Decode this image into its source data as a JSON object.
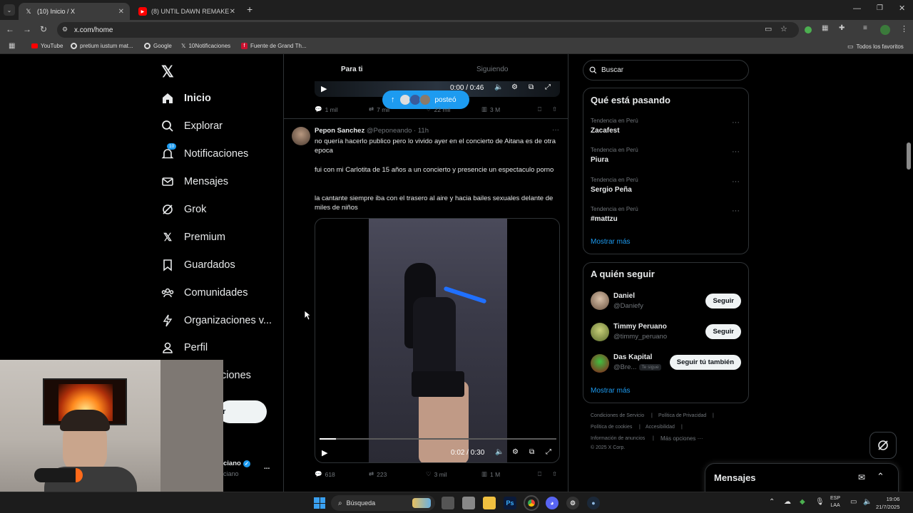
{
  "browser": {
    "tabs": [
      {
        "title": "(10) Inicio / X",
        "favicon": "x-logo-icon",
        "active": true
      },
      {
        "title": "(8) UNTIL DAWN REMAKE Gam",
        "favicon": "youtube-icon",
        "active": false
      }
    ],
    "new_tab_symbol": "+",
    "url": "x.com/home",
    "bookmarks": [
      {
        "label": "YouTube",
        "icon": "youtube-icon"
      },
      {
        "label": "pretium iustum mat...",
        "icon": "google-icon"
      },
      {
        "label": "Google",
        "icon": "google-icon"
      },
      {
        "label": "10Notificaciones",
        "icon": "x-logo-icon"
      },
      {
        "label": "Fuente de Grand Th...",
        "icon": "fandom-icon"
      }
    ],
    "all_bookmarks_label": "Todos los favoritos"
  },
  "sidebar": {
    "items": [
      {
        "label": "Inicio",
        "icon": "home-icon",
        "active": true
      },
      {
        "label": "Explorar",
        "icon": "search-icon"
      },
      {
        "label": "Notificaciones",
        "icon": "bell-icon",
        "badge": "10"
      },
      {
        "label": "Mensajes",
        "icon": "mail-icon"
      },
      {
        "label": "Grok",
        "icon": "grok-icon"
      },
      {
        "label": "Premium",
        "icon": "x-logo-icon"
      },
      {
        "label": "Guardados",
        "icon": "bookmark-icon"
      },
      {
        "label": "Comunidades",
        "icon": "communities-icon"
      },
      {
        "label": "Organizaciones v...",
        "icon": "lightning-icon"
      },
      {
        "label": "Perfil",
        "icon": "person-icon"
      },
      {
        "label": "ciones",
        "icon": "more-icon"
      }
    ],
    "post_button_fragment": "r",
    "account_name_fragment": "ciano",
    "account_handle_fragment": "ciano",
    "account_more": "..."
  },
  "feed": {
    "tabs": [
      {
        "label": "Para ti",
        "active": true
      },
      {
        "label": "Siguiendo",
        "active": false
      }
    ],
    "new_posts_pill": "posteó",
    "prev_tweet": {
      "video_time": "0:00 / 0:46",
      "replies": "1 mil",
      "retweets": "7 mil",
      "likes": "22 mil",
      "views": "3 M"
    },
    "tweet": {
      "author": "Pepon Sanchez",
      "handle": "@Peponeando",
      "time": "· 11h",
      "more": "···",
      "paragraphs": [
        "no quería hacerlo publico pero lo vivido ayer en el concierto de Aitana es de otra epoca",
        "fui con mi Carlotita de 15 años a un concierto y presencie un espectaculo porno",
        "la cantante siempre iba con el trasero al aire y hacia bailes sexuales delante de miles de niños"
      ],
      "video_time": "0:02 / 0:30",
      "video_progress": 0.07,
      "replies": "618",
      "retweets": "223",
      "likes": "3 mil",
      "views": "1 M"
    }
  },
  "right": {
    "search_placeholder": "Buscar",
    "trending_title": "Qué está pasando",
    "trends": [
      {
        "category": "Tendencia en Perú",
        "name": "Zacafest"
      },
      {
        "category": "Tendencia en Perú",
        "name": "Piura"
      },
      {
        "category": "Tendencia en Perú",
        "name": "Sergio Peña"
      },
      {
        "category": "Tendencia en Perú",
        "name": "#mattzu"
      }
    ],
    "trend_more": "···",
    "show_more": "Mostrar más",
    "follow_title": "A quién seguir",
    "follows": [
      {
        "name": "Daniel",
        "handle": "@Daniefy",
        "button": "Seguir"
      },
      {
        "name": "Timmy Peruano",
        "handle": "@timmy_peruano",
        "button": "Seguir"
      },
      {
        "name": "Das Kapital",
        "handle": "@Bre...",
        "badge": "Te sigue",
        "button": "Seguir tú también"
      }
    ],
    "follow_show_more": "Mostrar más",
    "footer_links": [
      "Condiciones de Servicio",
      "|",
      "Política de Privacidad",
      "|",
      "Política de cookies",
      "|",
      "Accesibilidad",
      "|",
      "Información de anuncios",
      "|",
      "Más opciones ···",
      "© 2025 X Corp."
    ],
    "messages_title": "Mensajes"
  },
  "taskbar": {
    "search_label": "Búsqueda",
    "lang_top": "ESP",
    "lang_bottom": "LAA",
    "time": "19:06",
    "date": "21/7/2025"
  },
  "colors": {
    "accent": "#1d9bf0",
    "text": "#e7e9ea",
    "muted": "#71767b",
    "border": "#2f3336"
  }
}
